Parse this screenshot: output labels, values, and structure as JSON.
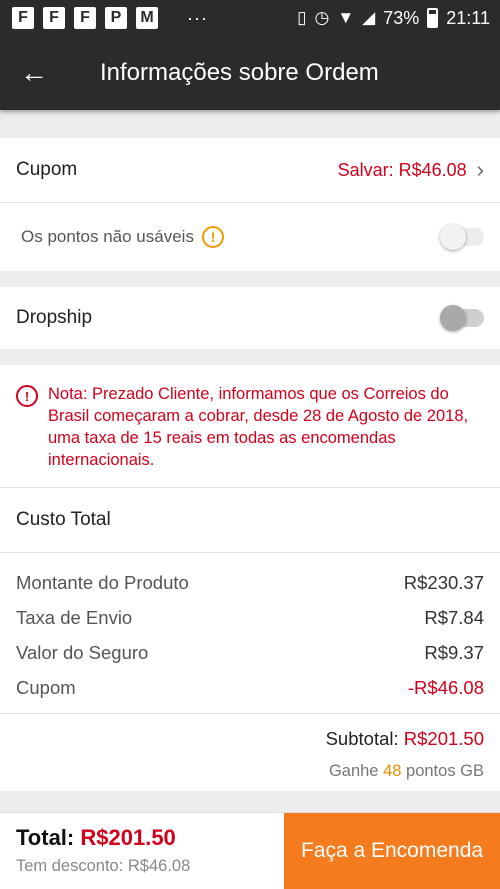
{
  "status_bar": {
    "notif_icons": [
      "F",
      "F",
      "F",
      "P",
      "M"
    ],
    "dots": "···",
    "battery_percent": "73%",
    "time": "21:11"
  },
  "app_bar": {
    "back_icon": "←",
    "title": "Informações sobre Ordem"
  },
  "coupon": {
    "label": "Cupom",
    "value": "Salvar: R$46.08",
    "chevron": "›"
  },
  "points": {
    "label": "Os pontos não usáveis",
    "info_icon": "!",
    "toggle_on": false
  },
  "dropship": {
    "label": "Dropship",
    "toggle_on": false
  },
  "notice": {
    "icon": "!",
    "text": "Nota: Prezado Cliente, informamos que os Correios do Brasil começaram a cobrar, desde 28 de Agosto de 2018, uma taxa de 15 reais em todas as encomendas internacionais."
  },
  "total_cost": {
    "heading": "Custo Total",
    "lines": [
      {
        "label": "Montante do Produto",
        "amount": "R$230.37"
      },
      {
        "label": "Taxa de Envio",
        "amount": "R$7.84"
      },
      {
        "label": "Valor do Seguro",
        "amount": "R$9.37"
      },
      {
        "label": "Cupom",
        "amount": "-R$46.08"
      }
    ],
    "subtotal_label": "Subtotal:",
    "subtotal_value": "R$201.50",
    "earn_prefix": "Ganhe",
    "earn_points": "48",
    "earn_suffix": "pontos GB"
  },
  "bottom": {
    "total_label": "Total:",
    "total_value": "R$201.50",
    "discount": "Tem desconto: R$46.08",
    "order_button": "Faça a Encomenda"
  },
  "colors": {
    "accent_red": "#d0021b",
    "orange_button": "#f57c1e",
    "points_orange": "#f08c00"
  }
}
